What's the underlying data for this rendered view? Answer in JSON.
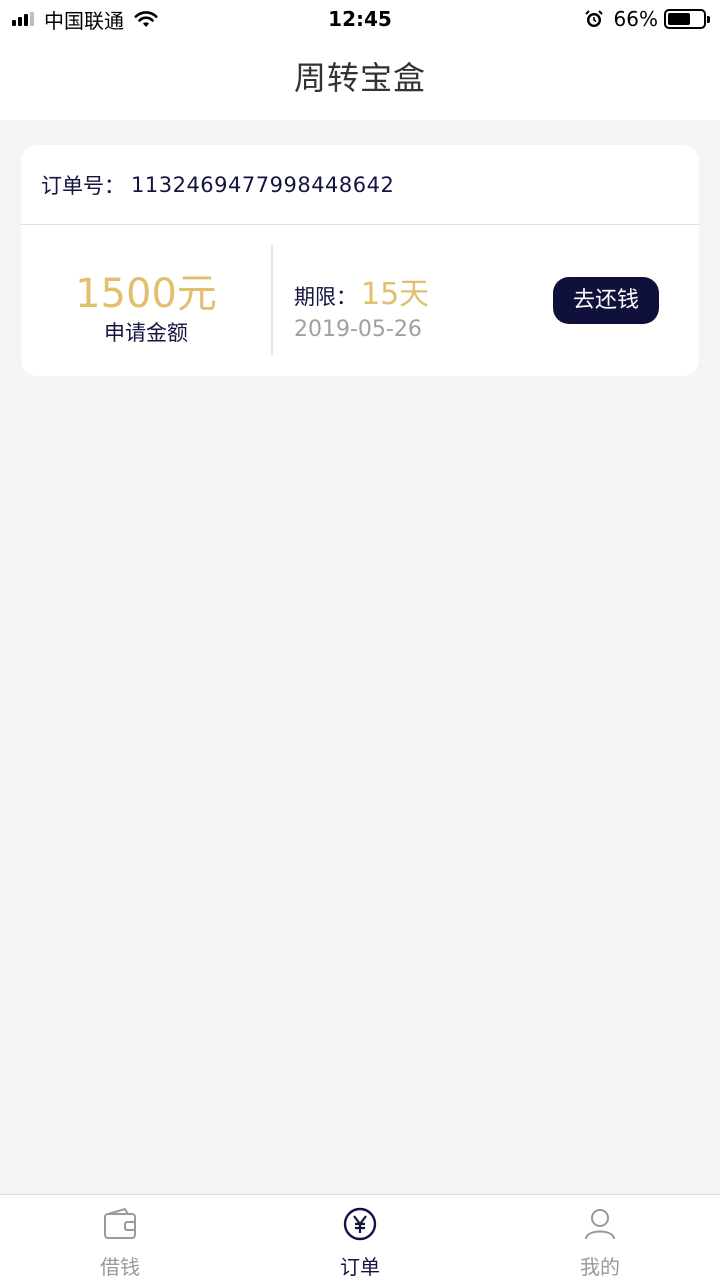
{
  "status_bar": {
    "carrier": "中国联通",
    "time": "12:45",
    "battery_percent": "66%",
    "battery_level": 0.66,
    "icons": [
      "signal-icon",
      "wifi-icon",
      "alarm-icon",
      "battery-icon"
    ]
  },
  "header": {
    "title": "周转宝盒"
  },
  "order": {
    "order_no_label": "订单号：",
    "order_no": "1132469477998448642",
    "amount": "1500元",
    "amount_label": "申请金额",
    "term_label": "期限：",
    "term_value": "15天",
    "date": "2019-05-26",
    "repay_button": "去还钱"
  },
  "tab_bar": {
    "items": [
      {
        "label": "借钱",
        "icon": "wallet-icon",
        "active": false
      },
      {
        "label": "订单",
        "icon": "yuan-circle-icon",
        "active": true
      },
      {
        "label": "我的",
        "icon": "user-icon",
        "active": false
      }
    ]
  },
  "colors": {
    "accent_gold": "#e2bf6d",
    "navy": "#10103c",
    "background": "#f4f4f4"
  }
}
